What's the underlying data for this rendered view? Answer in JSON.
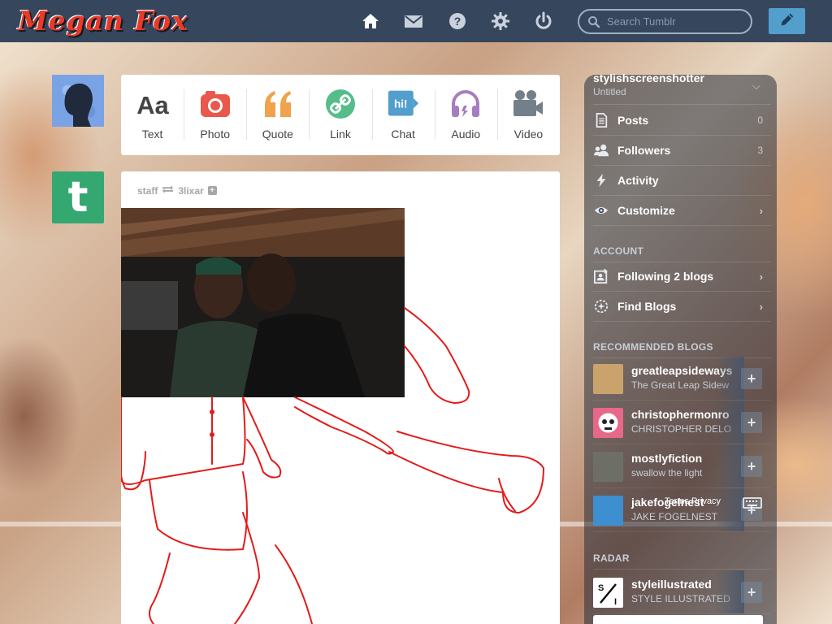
{
  "header": {
    "logo_text": "Megan Fox",
    "search_placeholder": "Search Tumblr",
    "nav": [
      "home-icon",
      "mail-icon",
      "help-icon",
      "gear-icon",
      "power-icon"
    ],
    "compose_icon": "pencil-icon"
  },
  "post_types": [
    {
      "label": "Text",
      "icon": "text-icon",
      "color": "#444444"
    },
    {
      "label": "Photo",
      "icon": "camera-icon",
      "color": "#e9584a"
    },
    {
      "label": "Quote",
      "icon": "quote-icon",
      "color": "#f0a24c"
    },
    {
      "label": "Link",
      "icon": "link-icon",
      "color": "#56bc8a"
    },
    {
      "label": "Chat",
      "icon": "chat-icon",
      "color": "#529ecc"
    },
    {
      "label": "Audio",
      "icon": "headphones-icon",
      "color": "#a77dc2"
    },
    {
      "label": "Video",
      "icon": "video-camera-icon",
      "color": "#748089"
    }
  ],
  "post": {
    "author": "staff",
    "reblogged_from": "3lixar"
  },
  "sidebar": {
    "blog_name": "stylishscreenshotter",
    "blog_subtitle": "Untitled",
    "items": [
      {
        "label": "Posts",
        "count": "0",
        "icon": "posts-icon"
      },
      {
        "label": "Followers",
        "count": "3",
        "icon": "followers-icon"
      },
      {
        "label": "Activity",
        "count": "",
        "icon": "lightning-icon"
      },
      {
        "label": "Customize",
        "count": "",
        "icon": "eye-icon"
      }
    ],
    "account_header": "ACCOUNT",
    "account_items": [
      {
        "label": "Following 2 blogs",
        "icon": "following-icon"
      },
      {
        "label": "Find Blogs",
        "icon": "compass-icon"
      }
    ],
    "recommended_header": "RECOMMENDED BLOGS",
    "recommended": [
      {
        "name": "greatleapsideways",
        "desc": "The Great Leap Sidew",
        "thumb": "#c9a36b"
      },
      {
        "name": "christophermonro",
        "desc": "CHRISTOPHER DELO",
        "thumb": "#e8688a"
      },
      {
        "name": "mostlyfiction",
        "desc": "swallow the light",
        "thumb": "#6d6f66"
      },
      {
        "name": "jakefogelnest",
        "desc": "JAKE FOGELNEST",
        "thumb": "#3e8fd0",
        "overlay": "Terms Privacy"
      }
    ],
    "radar_header": "RADAR",
    "radar": [
      {
        "name": "styleillustrated",
        "desc": "STYLE ILLUSTRATED",
        "thumb": "#ffffff"
      }
    ]
  }
}
